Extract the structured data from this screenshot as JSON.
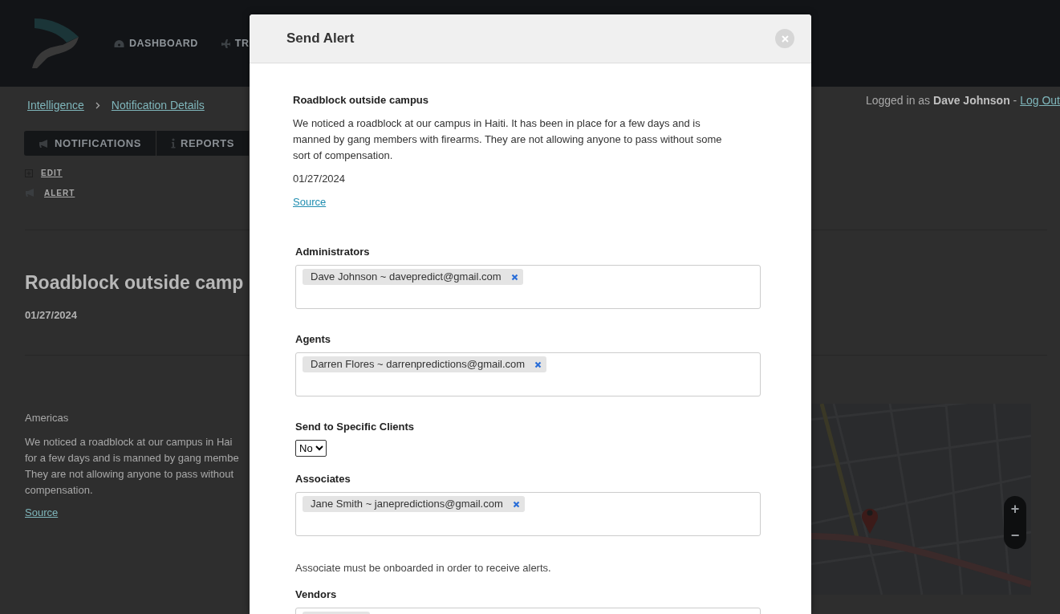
{
  "header": {
    "nav": [
      {
        "label": "DASHBOARD"
      },
      {
        "label": "TR"
      }
    ]
  },
  "breadcrumb": [
    {
      "label": "Intelligence"
    },
    {
      "label": "Notification Details"
    }
  ],
  "user": {
    "prefix": "Logged in as",
    "name": "Dave Johnson",
    "separator": "-",
    "logout": "Log Out"
  },
  "tabs": [
    {
      "label": "NOTIFICATIONS",
      "selected": false
    },
    {
      "label": "REPORTS",
      "selected": false
    }
  ],
  "actions": [
    {
      "label": "EDIT"
    },
    {
      "label": "ALERT"
    }
  ],
  "notification": {
    "title": "Roadblock outside camp",
    "date": "01/27/2024",
    "region": "Americas",
    "body_lines": [
      "We noticed a roadblock at our campus in Hai",
      "for a few days and is manned by gang membe",
      "They are not allowing anyone to pass without",
      "compensation."
    ],
    "source": "Source"
  },
  "map": {
    "kind": "picture",
    "zoom_in": "+",
    "zoom_out": "−"
  },
  "modal": {
    "title": "Send Alert",
    "notification": {
      "title": "Roadblock outside campus",
      "body": "We noticed a roadblock at our campus in Haiti. It has been in place for a few days and is manned by gang members with firearms. They are not allowing anyone to pass without some sort of compensation.",
      "date": "01/27/2024",
      "source": "Source"
    },
    "fields": [
      {
        "kind": "tags",
        "label": "Administrators",
        "tags": [
          {
            "label": "Dave Johnson ~ davepredict@gmail.com"
          }
        ]
      },
      {
        "kind": "tags",
        "label": "Agents",
        "tags": [
          {
            "label": "Darren Flores ~ darrenpredictions@gmail.com"
          }
        ]
      },
      {
        "kind": "select",
        "label": "Send to Specific Clients",
        "value": "No"
      },
      {
        "kind": "tags",
        "label": "Associates",
        "tags": [
          {
            "label": "Jane Smith ~ janepredictions@gmail.com"
          }
        ],
        "note": "Associate must be onboarded in order to receive alerts."
      },
      {
        "kind": "tags",
        "label": "Vendors",
        "clipped_tag": true
      }
    ]
  }
}
